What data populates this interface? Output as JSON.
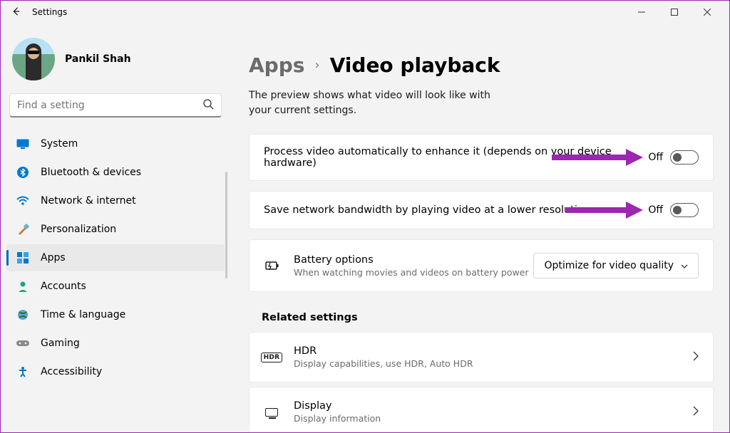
{
  "window": {
    "title": "Settings"
  },
  "user": {
    "name": "Pankil Shah"
  },
  "search": {
    "placeholder": "Find a setting"
  },
  "nav": {
    "items": [
      {
        "label": "System"
      },
      {
        "label": "Bluetooth & devices"
      },
      {
        "label": "Network & internet"
      },
      {
        "label": "Personalization"
      },
      {
        "label": "Apps"
      },
      {
        "label": "Accounts"
      },
      {
        "label": "Time & language"
      },
      {
        "label": "Gaming"
      },
      {
        "label": "Accessibility"
      }
    ]
  },
  "breadcrumb": {
    "parent": "Apps",
    "current": "Video playback"
  },
  "description": "The preview shows what video will look like with your current settings.",
  "settings": {
    "enhance": {
      "label": "Process video automatically to enhance it (depends on your device hardware)",
      "state": "Off"
    },
    "bandwidth": {
      "label": "Save network bandwidth by playing video at a lower resolution",
      "state": "Off"
    },
    "battery": {
      "title": "Battery options",
      "subtitle": "When watching movies and videos on battery power",
      "dropdown": "Optimize for video quality"
    }
  },
  "related": {
    "heading": "Related settings",
    "hdr": {
      "title": "HDR",
      "subtitle": "Display capabilities, use HDR, Auto HDR"
    },
    "display": {
      "title": "Display",
      "subtitle": "Display information"
    }
  }
}
